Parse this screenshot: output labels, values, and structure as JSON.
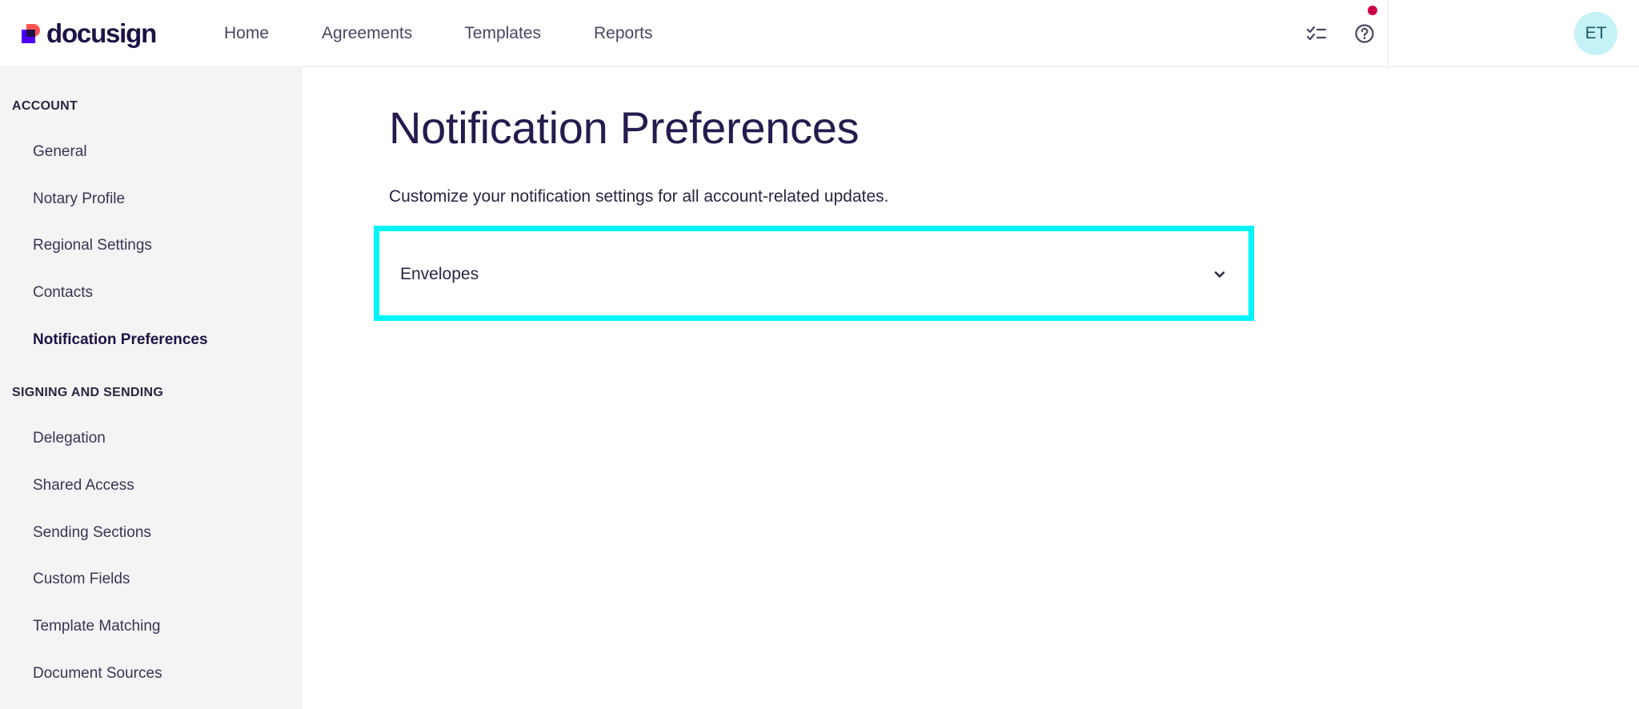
{
  "brand": {
    "name": "docusign"
  },
  "topnav": {
    "items": [
      {
        "label": "Home"
      },
      {
        "label": "Agreements"
      },
      {
        "label": "Templates"
      },
      {
        "label": "Reports"
      }
    ],
    "avatar_initials": "ET"
  },
  "sidebar": {
    "sections": [
      {
        "title": "ACCOUNT",
        "items": [
          "General",
          "Notary Profile",
          "Regional Settings",
          "Contacts",
          "Notification Preferences"
        ]
      },
      {
        "title": "SIGNING AND SENDING",
        "items": [
          "Delegation",
          "Shared Access",
          "Sending Sections",
          "Custom Fields",
          "Template Matching",
          "Document Sources"
        ]
      }
    ],
    "active_item": "Notification Preferences"
  },
  "main": {
    "title": "Notification Preferences",
    "subtitle": "Customize your notification settings for all account-related updates.",
    "accordion": {
      "label": "Envelopes",
      "expanded": false
    }
  },
  "colors": {
    "accent_highlight": "#00f5fa",
    "notification_dot": "#cc0044",
    "avatar_bg": "#c5f2f6",
    "title_text": "#261a4e"
  }
}
